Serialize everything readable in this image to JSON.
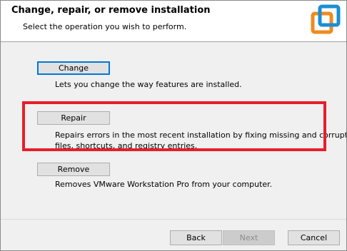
{
  "header": {
    "title": "Change, repair, or remove installation",
    "subtitle": "Select the operation you wish to perform.",
    "logo_icon": "vmware-logo-icon"
  },
  "options": {
    "change": {
      "label": "Change",
      "description": "Lets you change the way features are installed."
    },
    "repair": {
      "label": "Repair",
      "description_line1": "Repairs errors in the most recent installation by fixing missing and corrupt",
      "description_line2": "files, shortcuts, and registry entries."
    },
    "remove": {
      "label": "Remove",
      "description": "Removes VMware Workstation Pro from your computer."
    }
  },
  "footer": {
    "back_label": "Back",
    "next_label": "Next",
    "cancel_label": "Cancel"
  },
  "colors": {
    "highlight": "#e61e2a",
    "logo_blue": "#1a8fd6",
    "logo_orange": "#f08a1e",
    "focus": "#0078d7"
  }
}
